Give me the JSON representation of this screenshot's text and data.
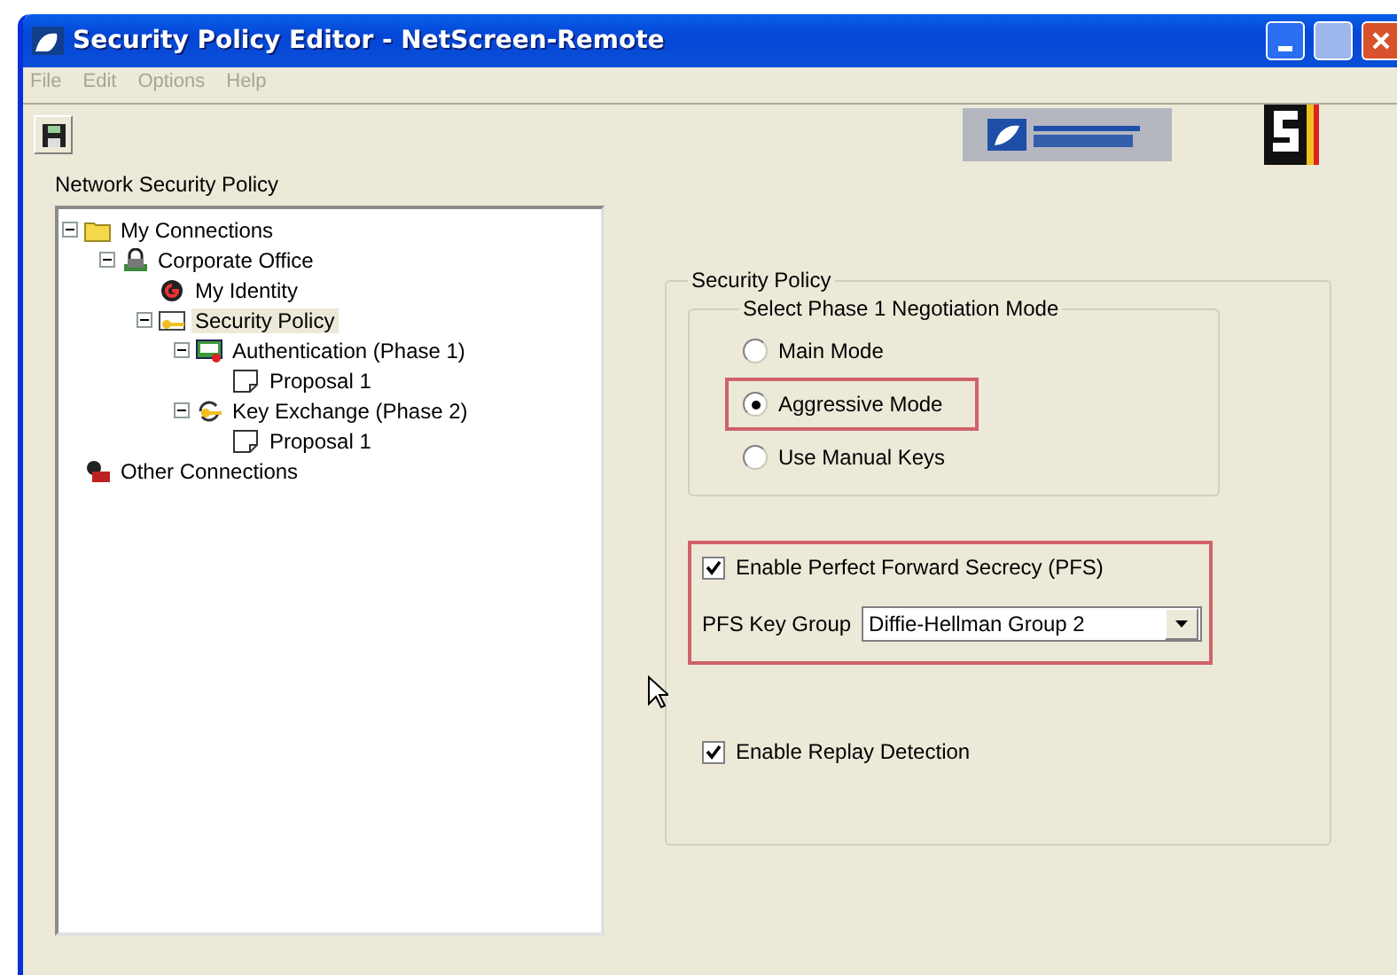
{
  "window": {
    "title": "Security Policy Editor - NetScreen-Remote"
  },
  "menu": [
    {
      "label": "File",
      "disabled": true
    },
    {
      "label": "Edit",
      "disabled": true
    },
    {
      "label": "Options",
      "disabled": true
    },
    {
      "label": "Help",
      "disabled": true
    }
  ],
  "tree": {
    "title": "Network Security Policy",
    "items": [
      {
        "label": "My Connections",
        "kind": "folder",
        "expanded": true,
        "selected": false,
        "children": [
          {
            "label": "Corporate Office",
            "kind": "connection",
            "expanded": true,
            "selected": false,
            "children": [
              {
                "label": "My Identity",
                "kind": "identity",
                "selected": false
              },
              {
                "label": "Security Policy",
                "kind": "policy",
                "expanded": true,
                "selected": true,
                "children": [
                  {
                    "label": "Authentication (Phase 1)",
                    "kind": "auth",
                    "expanded": true,
                    "selected": false,
                    "children": [
                      {
                        "label": "Proposal 1",
                        "kind": "proposal",
                        "selected": false
                      }
                    ]
                  },
                  {
                    "label": "Key Exchange (Phase 2)",
                    "kind": "keys",
                    "expanded": true,
                    "selected": false,
                    "children": [
                      {
                        "label": "Proposal 1",
                        "kind": "proposal",
                        "selected": false
                      }
                    ]
                  }
                ]
              }
            ]
          }
        ]
      },
      {
        "label": "Other Connections",
        "kind": "other",
        "selected": false
      }
    ]
  },
  "policy": {
    "title": "Security Policy",
    "mode_group": {
      "title": "Select Phase 1 Negotiation Mode",
      "options": [
        {
          "label": "Main Mode",
          "selected": false,
          "highlighted": false
        },
        {
          "label": "Aggressive Mode",
          "selected": true,
          "highlighted": true
        },
        {
          "label": "Use Manual Keys",
          "selected": false,
          "highlighted": false
        }
      ]
    },
    "pfs": {
      "highlighted": true,
      "checkbox": {
        "label": "Enable Perfect Forward Secrecy (PFS)",
        "checked": true
      },
      "key_group": {
        "label": "PFS Key Group",
        "value": "Diffie-Hellman Group 2"
      }
    },
    "replay": {
      "label": "Enable Replay Detection",
      "checked": true
    }
  }
}
